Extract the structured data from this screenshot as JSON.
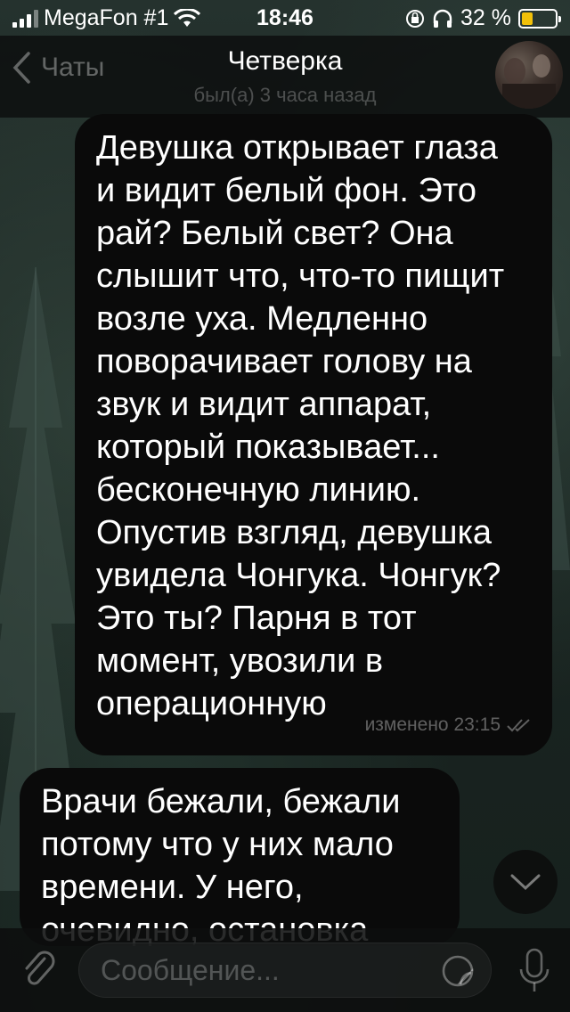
{
  "status_bar": {
    "carrier": "MegaFon #1",
    "time": "18:46",
    "battery_percent": "32 %",
    "battery_level": 0.32,
    "icons": [
      "signal-icon",
      "wifi-icon",
      "rotation-lock-icon",
      "headphones-icon",
      "battery-icon"
    ]
  },
  "header": {
    "back_label": "Чаты",
    "title": "Четверка",
    "subtitle": "был(а) 3 часа назад"
  },
  "messages": [
    {
      "direction": "outgoing",
      "lines": [
        "Девушка открывает глаза",
        "и видит белый фон. Это",
        "рай? Белый свет? Она",
        "слышит что, что-то пищит",
        "возле уха. Медленно",
        "поворачивает голову на",
        "звук и видит аппарат,",
        "который показывает...",
        "бесконечную линию.",
        "Опустив взгляд, девушка",
        "увидела Чонгука. Чонгук?",
        "Это ты? Парня в тот",
        "момент, увозили в",
        "операционную"
      ],
      "meta": "изменено 23:15",
      "status_icon": "double-check-icon"
    },
    {
      "direction": "incoming",
      "lines": [
        "Врачи бежали, бежали",
        "потому что у них мало",
        "времени. У него,",
        "очевидно, остановка"
      ]
    }
  ],
  "input": {
    "placeholder": "Сообщение..."
  },
  "colors": {
    "bubble": "#0a0a0a",
    "battery_fill": "#f2c10a",
    "bars": "#0c0e0e"
  }
}
